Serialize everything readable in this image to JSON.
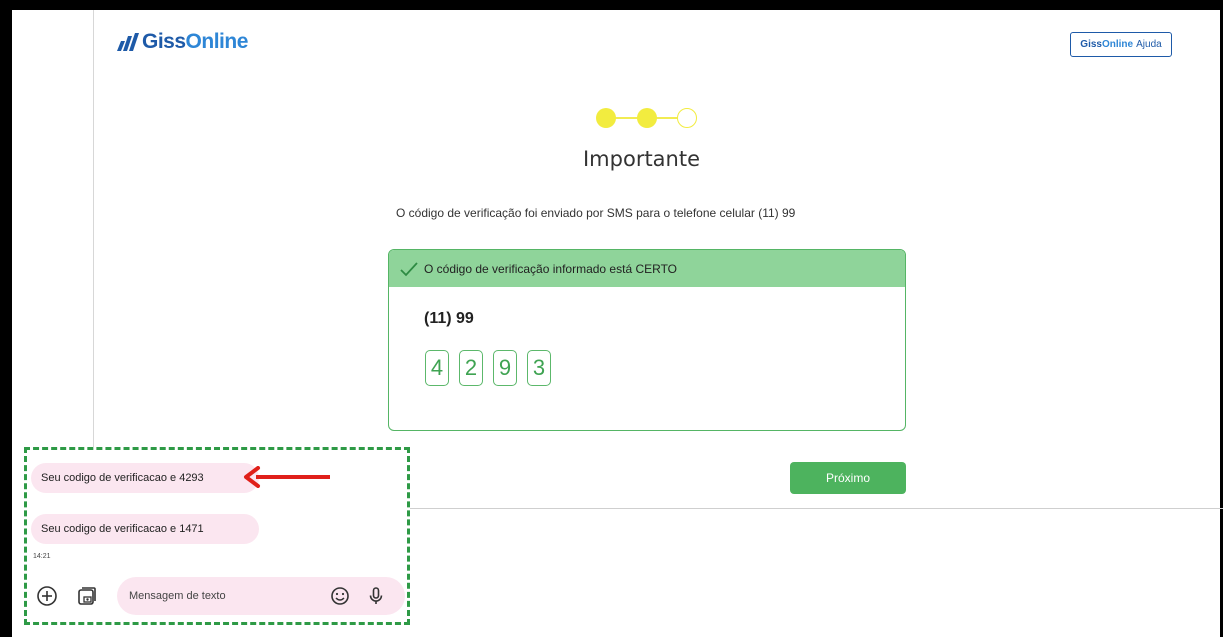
{
  "header": {
    "logo_part1": "Giss",
    "logo_part2": "Online",
    "help_part1": "Giss",
    "help_part2": "Online",
    "help_part3": "Ajuda"
  },
  "steps": {
    "total": 3,
    "completed": 2,
    "color": "#f2ec3f"
  },
  "main": {
    "title": "Importante",
    "subtitle": "O código de verificação foi enviado por SMS para o telefone celular (11) 99",
    "success_message": "O código de verificação informado está CERTO",
    "phone": "(11) 99",
    "code_digits": [
      "4",
      "2",
      "9",
      "3"
    ],
    "next_label": "Próximo"
  },
  "sms": {
    "messages": [
      {
        "text": "Seu codigo de verificacao e 4293"
      },
      {
        "text": "Seu codigo de verificacao e 1471"
      }
    ],
    "time": "14:21",
    "input_placeholder": "Mensagem de texto"
  },
  "colors": {
    "brand_dark": "#1e5aa8",
    "brand_light": "#2e86d6",
    "success_bg": "#8fd49a",
    "success_border": "#55b565",
    "primary_button": "#4db35e",
    "annotation_border": "#2e9a46",
    "annotation_arrow": "#e0201a",
    "sms_bubble": "#fbe6f0"
  }
}
